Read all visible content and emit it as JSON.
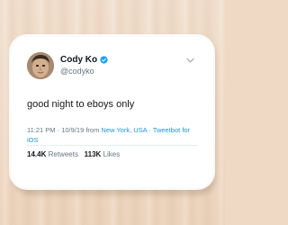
{
  "tweet": {
    "display_name": "Cody Ko",
    "handle": "@codyko",
    "verified": true,
    "text": "good night to eboys only",
    "time_date": "11:21 PM · 10/9/19 from ",
    "location": "New York, USA",
    "separator": " · ",
    "source": "Tweetbot for iOS",
    "retweets_count": "14.4K",
    "retweets_label": "Retweets",
    "likes_count": "113K",
    "likes_label": "Likes"
  },
  "icons": {
    "verified": "verified-badge-icon",
    "menu": "chevron-down-icon",
    "avatar": "profile-photo"
  },
  "colors": {
    "link": "#1b95e0",
    "verified": "#1da1f2",
    "text": "#14171a",
    "secondary": "#657786",
    "floor": "#efd9c4",
    "mat": "#ffffff"
  }
}
